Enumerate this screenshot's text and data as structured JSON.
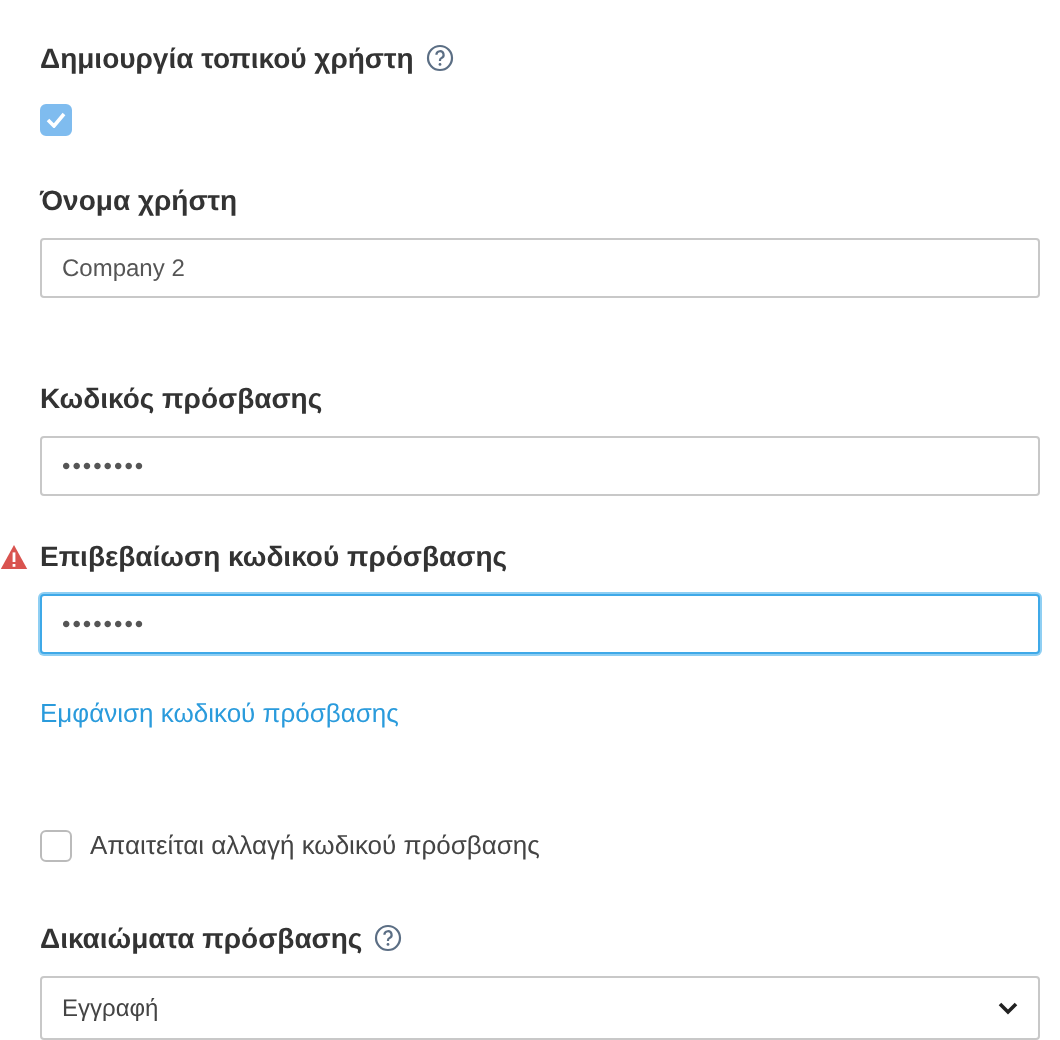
{
  "create_local_user": {
    "label": "Δημιουργία τοπικού χρήστη",
    "checked": true
  },
  "username": {
    "label": "Όνομα χρήστη",
    "value": "Company 2",
    "warning": false,
    "focused": false
  },
  "password": {
    "label": "Κωδικός πρόσβασης",
    "value": "••••••••",
    "warning": false,
    "focused": false
  },
  "confirm_password": {
    "label": "Επιβεβαίωση κωδικού πρόσβασης",
    "value": "••••••••",
    "warning": true,
    "focused": true
  },
  "show_password_link": "Εμφάνιση κωδικού πρόσβασης",
  "require_change": {
    "label": "Απαιτείται αλλαγή κωδικού πρόσβασης",
    "checked": false
  },
  "access_rights": {
    "label": "Δικαιώματα πρόσβασης",
    "value": "Εγγραφή"
  }
}
